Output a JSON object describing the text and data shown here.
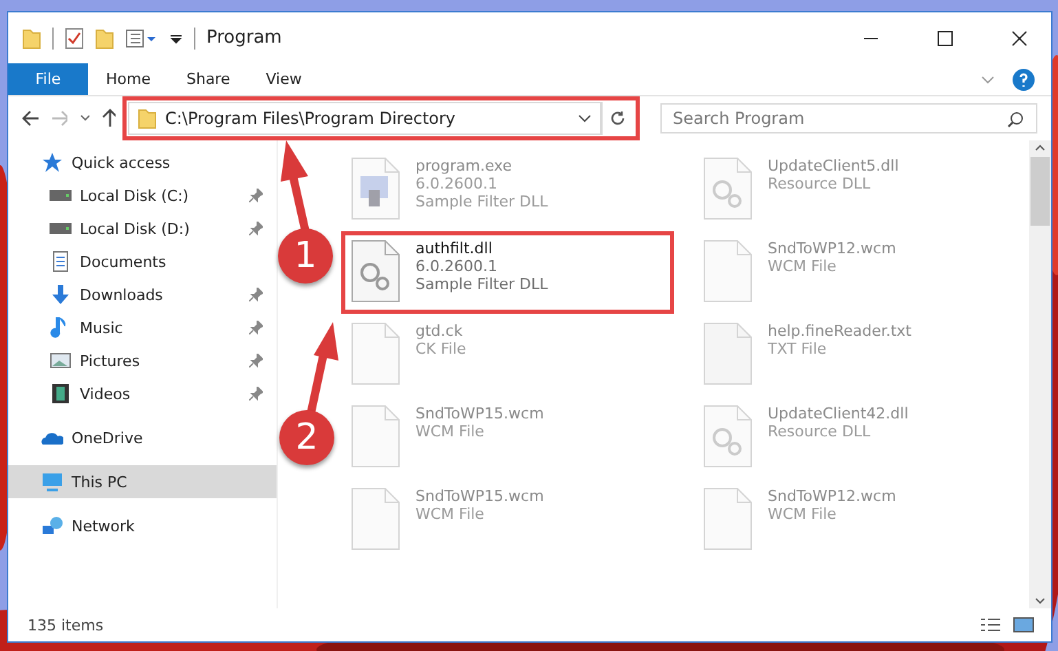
{
  "window": {
    "title": "Program"
  },
  "ribbon_tabs": [
    {
      "label": "File",
      "selected": true
    },
    {
      "label": "Home",
      "selected": false
    },
    {
      "label": "Share",
      "selected": false
    },
    {
      "label": "View",
      "selected": false
    }
  ],
  "address": {
    "value": "C:\\Program Files\\Program Directory",
    "highlighted": true
  },
  "search": {
    "placeholder": "Search Program"
  },
  "sidebar": {
    "items": [
      {
        "label": "Quick access",
        "kind": "star",
        "pinned": false,
        "selected": false,
        "children": [
          {
            "label": "Local Disk (C:)",
            "kind": "drive",
            "pinned": true,
            "selected": false
          },
          {
            "label": "Local Disk (D:)",
            "kind": "drive",
            "pinned": true,
            "selected": false
          },
          {
            "label": "Documents",
            "kind": "docs",
            "pinned": false,
            "selected": false
          },
          {
            "label": "Downloads",
            "kind": "download",
            "pinned": true,
            "selected": false
          },
          {
            "label": "Music",
            "kind": "music",
            "pinned": true,
            "selected": false
          },
          {
            "label": "Pictures",
            "kind": "pictures",
            "pinned": true,
            "selected": false
          },
          {
            "label": "Videos",
            "kind": "videos",
            "pinned": true,
            "selected": false
          }
        ]
      },
      {
        "label": "OneDrive",
        "kind": "cloud",
        "pinned": false,
        "selected": false
      },
      {
        "label": "This PC",
        "kind": "pc",
        "pinned": false,
        "selected": true
      },
      {
        "label": "Network",
        "kind": "network",
        "pinned": false,
        "selected": false
      }
    ]
  },
  "files": [
    {
      "name": "program.exe",
      "lines": [
        "6.0.2600.1",
        "Sample Filter DLL"
      ],
      "kind": "exe",
      "dimmed": true,
      "highlighted": false
    },
    {
      "name": "UpdateClient5.dll",
      "lines": [
        "Resource DLL"
      ],
      "kind": "dll",
      "dimmed": true,
      "highlighted": false
    },
    {
      "name": "authfilt.dll",
      "lines": [
        "6.0.2600.1",
        "Sample Filter DLL"
      ],
      "kind": "dll",
      "dimmed": false,
      "highlighted": true
    },
    {
      "name": "SndToWP12.wcm",
      "lines": [
        "WCM File"
      ],
      "kind": "blank",
      "dimmed": true,
      "highlighted": false
    },
    {
      "name": "gtd.ck",
      "lines": [
        "CK File"
      ],
      "kind": "blank",
      "dimmed": true,
      "highlighted": false
    },
    {
      "name": "help.fineReader.txt",
      "lines": [
        "TXT File"
      ],
      "kind": "text",
      "dimmed": true,
      "highlighted": false
    },
    {
      "name": "SndToWP15.wcm",
      "lines": [
        "WCM File"
      ],
      "kind": "blank",
      "dimmed": true,
      "highlighted": false
    },
    {
      "name": "UpdateClient42.dll",
      "lines": [
        "Resource DLL"
      ],
      "kind": "dll",
      "dimmed": true,
      "highlighted": false
    },
    {
      "name": "SndToWP15.wcm",
      "lines": [
        "WCM File"
      ],
      "kind": "blank",
      "dimmed": true,
      "highlighted": false
    },
    {
      "name": "SndToWP12.wcm",
      "lines": [
        "WCM File"
      ],
      "kind": "blank",
      "dimmed": true,
      "highlighted": false
    }
  ],
  "status_bar": {
    "count": "135 items"
  },
  "annotations": [
    {
      "label": "1"
    },
    {
      "label": "2"
    }
  ]
}
